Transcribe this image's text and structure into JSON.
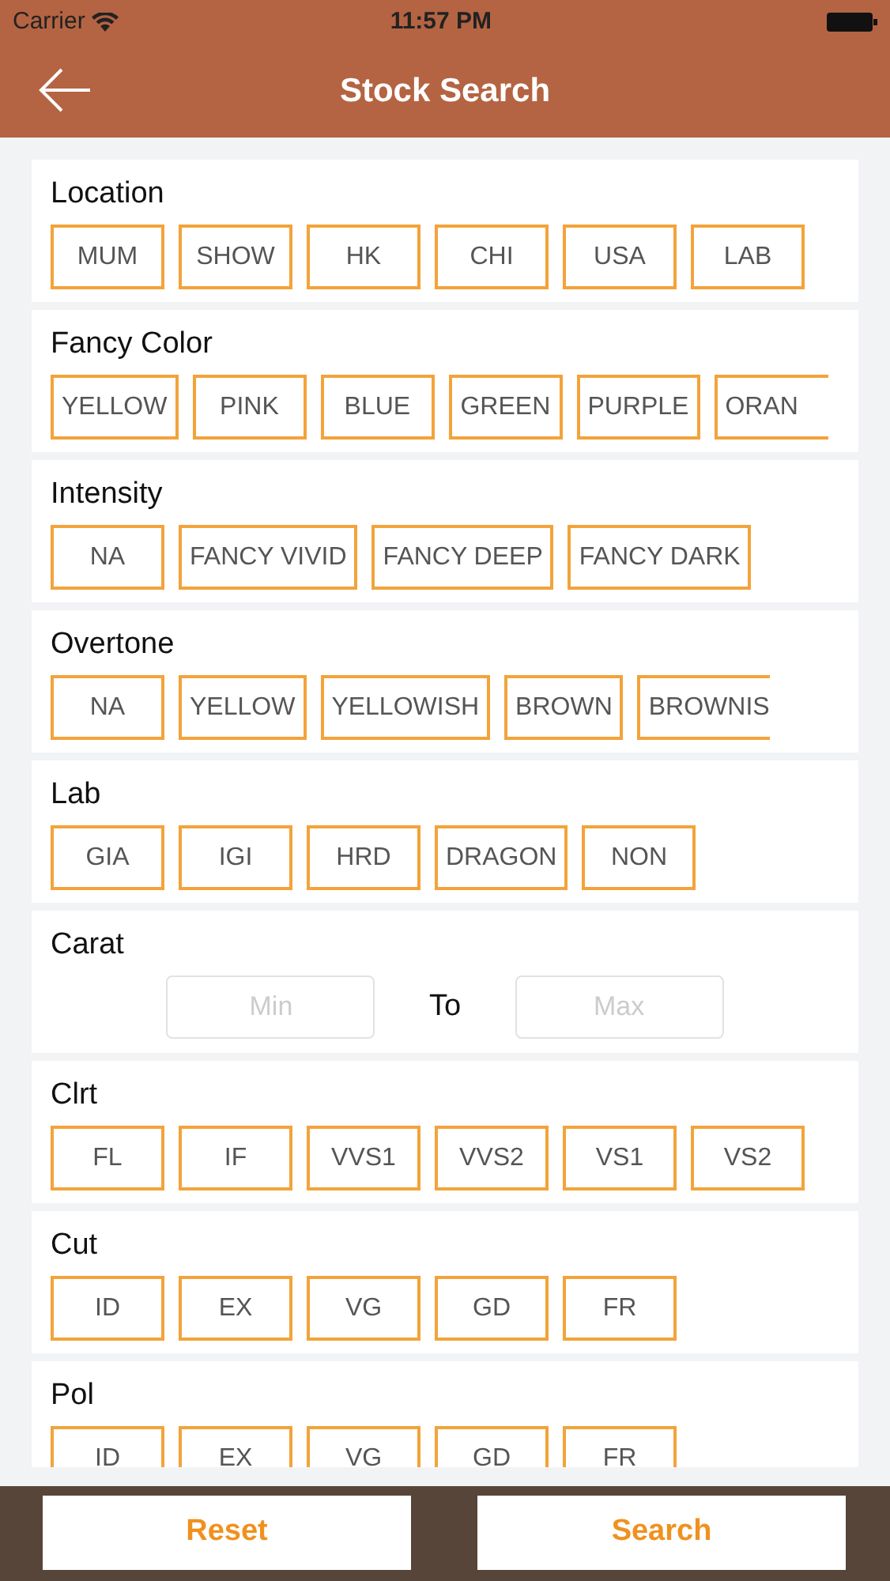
{
  "status_bar": {
    "carrier": "Carrier",
    "time": "11:57 PM"
  },
  "nav": {
    "title": "Stock Search"
  },
  "sections": [
    {
      "kind": "chips",
      "title": "Location",
      "options": [
        {
          "label": "MUM",
          "selected": false
        },
        {
          "label": "SHOW",
          "selected": false
        },
        {
          "label": "HK",
          "selected": false
        },
        {
          "label": "CHI",
          "selected": false
        },
        {
          "label": "USA",
          "selected": false
        },
        {
          "label": "LAB",
          "selected": false
        }
      ]
    },
    {
      "kind": "chips",
      "title": "Fancy Color",
      "options": [
        {
          "label": "YELLOW",
          "selected": false
        },
        {
          "label": "PINK",
          "selected": false
        },
        {
          "label": "BLUE",
          "selected": false
        },
        {
          "label": "GREEN",
          "selected": false
        },
        {
          "label": "PURPLE",
          "selected": false
        },
        {
          "label": "ORAN",
          "selected": false,
          "cut": true
        }
      ]
    },
    {
      "kind": "chips",
      "title": "Intensity",
      "options": [
        {
          "label": "NA",
          "selected": false
        },
        {
          "label": "FANCY VIVID",
          "selected": false
        },
        {
          "label": "FANCY DEEP",
          "selected": false
        },
        {
          "label": "FANCY DARK",
          "selected": false
        }
      ]
    },
    {
      "kind": "chips",
      "title": "Overtone",
      "options": [
        {
          "label": "NA",
          "selected": false
        },
        {
          "label": "YELLOW",
          "selected": false
        },
        {
          "label": "YELLOWISH",
          "selected": false
        },
        {
          "label": "BROWN",
          "selected": false
        },
        {
          "label": "BROWNIS",
          "selected": false,
          "cut": true
        }
      ]
    },
    {
      "kind": "chips",
      "title": "Lab",
      "options": [
        {
          "label": "GIA",
          "selected": false
        },
        {
          "label": "IGI",
          "selected": false
        },
        {
          "label": "HRD",
          "selected": false
        },
        {
          "label": "DRAGON",
          "selected": false
        },
        {
          "label": "NON",
          "selected": false
        }
      ]
    },
    {
      "kind": "range",
      "title": "Carat",
      "min_placeholder": "Min",
      "separator": "To",
      "max_placeholder": "Max"
    },
    {
      "kind": "chips",
      "title": "Clrt",
      "options": [
        {
          "label": "FL",
          "selected": false
        },
        {
          "label": "IF",
          "selected": false
        },
        {
          "label": "VVS1",
          "selected": false
        },
        {
          "label": "VVS2",
          "selected": false
        },
        {
          "label": "VS1",
          "selected": false
        },
        {
          "label": "VS2",
          "selected": false
        }
      ]
    },
    {
      "kind": "chips",
      "title": "Cut",
      "options": [
        {
          "label": "ID",
          "selected": false
        },
        {
          "label": "EX",
          "selected": false
        },
        {
          "label": "VG",
          "selected": false
        },
        {
          "label": "GD",
          "selected": false
        },
        {
          "label": "FR",
          "selected": false
        }
      ]
    },
    {
      "kind": "chips",
      "title": "Pol",
      "options": [
        {
          "label": "ID",
          "selected": false
        },
        {
          "label": "EX",
          "selected": false
        },
        {
          "label": "VG",
          "selected": false
        },
        {
          "label": "GD",
          "selected": false
        },
        {
          "label": "FR",
          "selected": false
        }
      ]
    }
  ],
  "buttons": [
    "Reset",
    "Search"
  ]
}
